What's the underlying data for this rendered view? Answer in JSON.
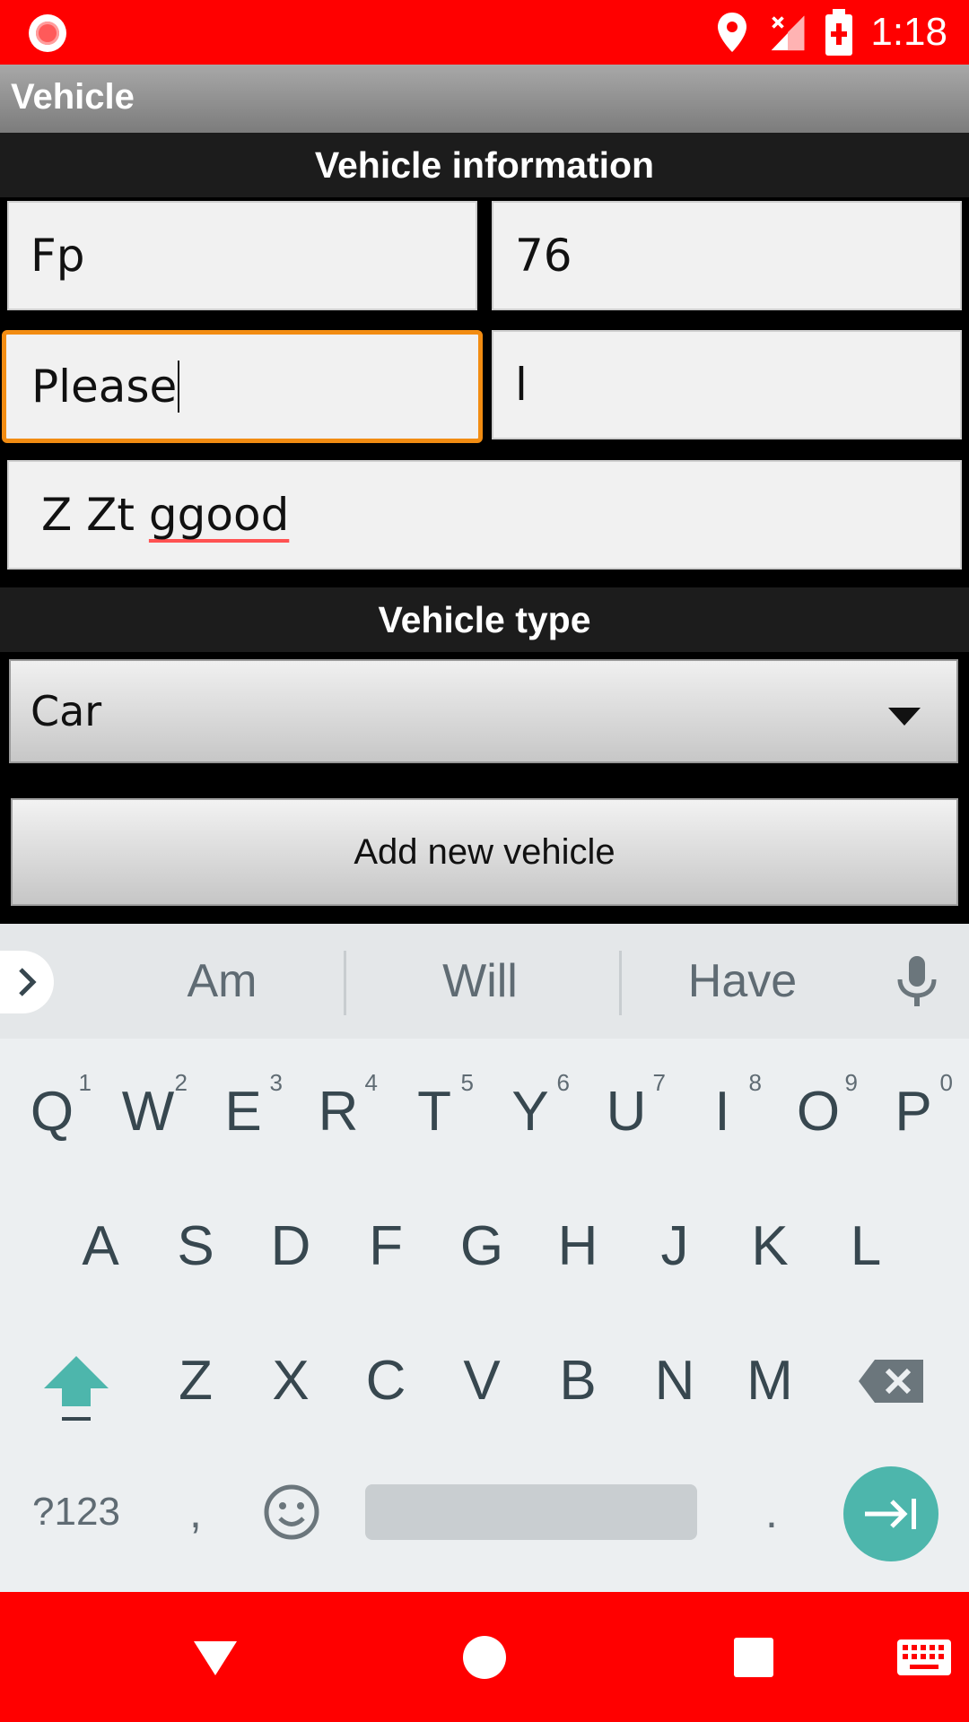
{
  "status_bar": {
    "time": "1:18",
    "icons": [
      "record-icon",
      "location-icon",
      "signal-icon",
      "battery-charging-icon"
    ]
  },
  "app_bar": {
    "title": "Vehicle"
  },
  "form": {
    "info_header": "Vehicle information",
    "fields": {
      "field1": "Fp",
      "field2": "76",
      "field3": "Please",
      "field4": "l",
      "field5_prefix": "Z Zt ",
      "field5_misspelled": "ggood"
    },
    "type_header": "Vehicle type",
    "vehicle_type_selected": "Car",
    "add_button_label": "Add new vehicle"
  },
  "keyboard": {
    "suggestions": [
      "Am",
      "Will",
      "Have"
    ],
    "row1": [
      {
        "key": "Q",
        "hint": "1"
      },
      {
        "key": "W",
        "hint": "2"
      },
      {
        "key": "E",
        "hint": "3"
      },
      {
        "key": "R",
        "hint": "4"
      },
      {
        "key": "T",
        "hint": "5"
      },
      {
        "key": "Y",
        "hint": "6"
      },
      {
        "key": "U",
        "hint": "7"
      },
      {
        "key": "I",
        "hint": "8"
      },
      {
        "key": "O",
        "hint": "9"
      },
      {
        "key": "P",
        "hint": "0"
      }
    ],
    "row2": [
      "A",
      "S",
      "D",
      "F",
      "G",
      "H",
      "J",
      "K",
      "L"
    ],
    "row3": [
      "Z",
      "X",
      "C",
      "V",
      "B",
      "N",
      "M"
    ],
    "symbols_key": "?123",
    "comma_key": ",",
    "period_key": "."
  },
  "colors": {
    "system_bars": "#ff0000",
    "focus_border": "#f28c12",
    "enter_key": "#4db6ac"
  }
}
